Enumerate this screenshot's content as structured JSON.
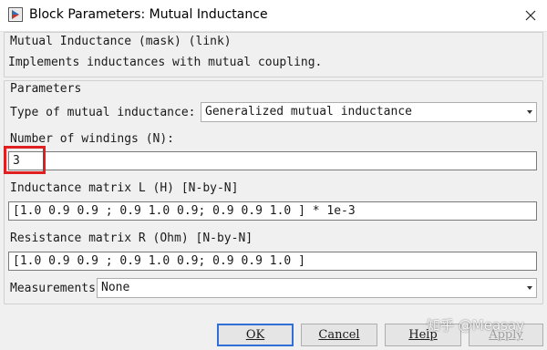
{
  "window": {
    "title": "Block Parameters: Mutual Inductance",
    "icon": "simulink-block-icon",
    "close_icon": "close-icon"
  },
  "description": {
    "heading": "Mutual Inductance (mask) (link)",
    "text": "Implements inductances with mutual coupling."
  },
  "parameters": {
    "group_label": "Parameters",
    "type_label": "Type of mutual inductance:",
    "type_value": "Generalized mutual inductance",
    "windings_label": "Number of windings (N):",
    "windings_value": "3",
    "inductance_label": "Inductance matrix L (H) [N-by-N]",
    "inductance_value": "[1.0 0.9  0.9 ;  0.9 1.0  0.9;  0.9 0.9 1.0 ] * 1e-3",
    "resistance_label": "Resistance matrix R (Ohm) [N-by-N]",
    "resistance_value": "[1.0 0.9  0.9 ;  0.9 1.0  0.9;  0.9 0.9 1.0 ]",
    "measurements_label": "Measurements",
    "measurements_value": "None"
  },
  "buttons": {
    "ok": "OK",
    "cancel": "Cancel",
    "help": "Help",
    "apply": "Apply"
  },
  "watermark": "知乎 @Measay",
  "colors": {
    "highlight": "#e02020",
    "default_button_border": "#2f6fd6",
    "dialog_background": "#f0f0f0"
  }
}
